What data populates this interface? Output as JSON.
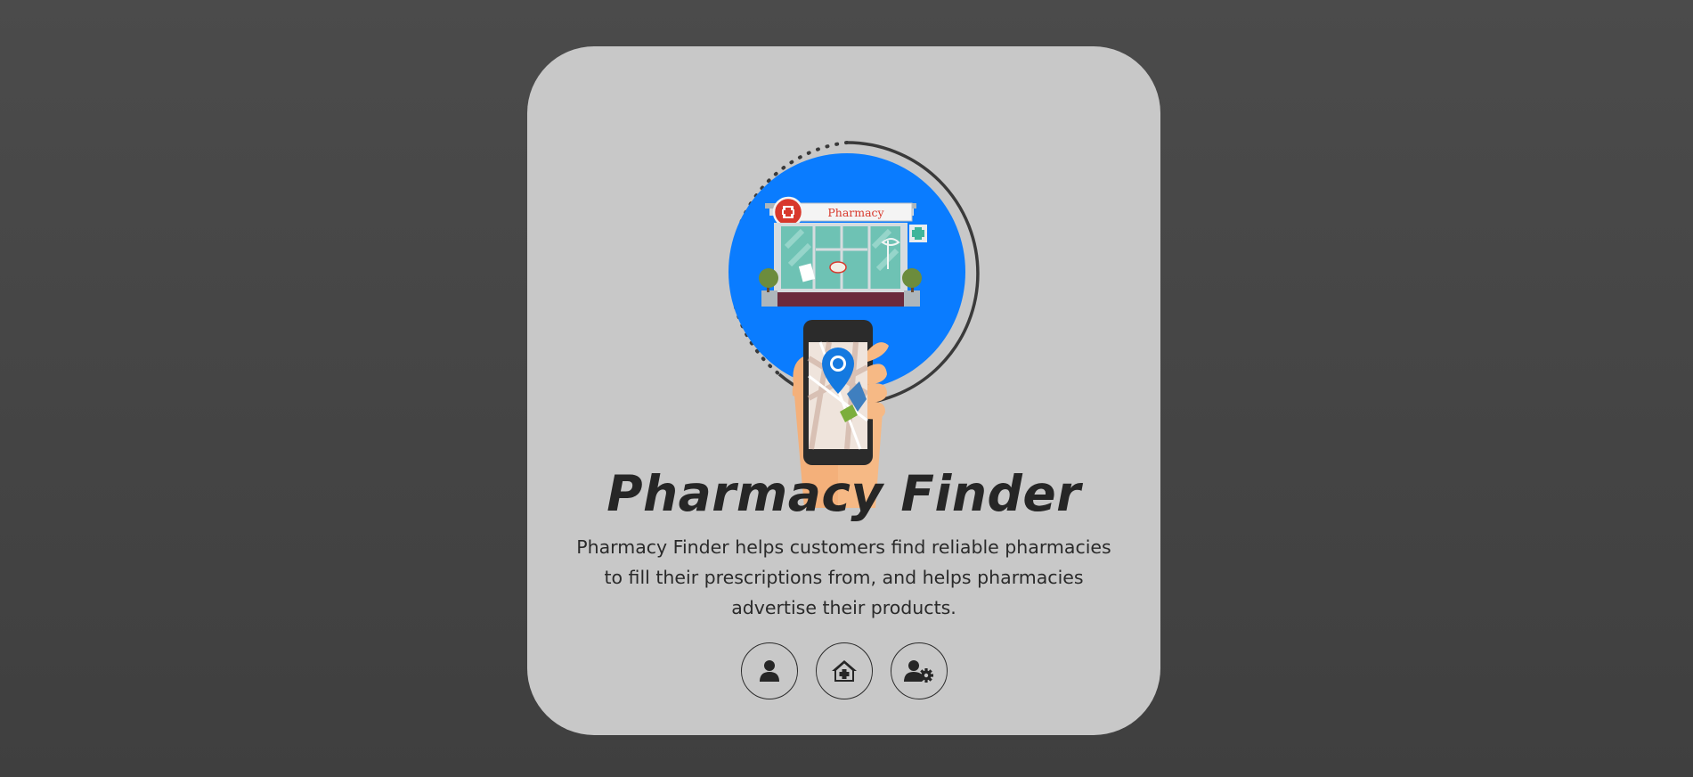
{
  "hero": {
    "sign_text": "Pharmacy"
  },
  "title": "Pharmacy Finder",
  "description": "Pharmacy Finder helps customers find reliable pharmacies to fill their prescriptions from, and helps pharmacies advertise their products.",
  "actions": [
    {
      "icon": "user-icon"
    },
    {
      "icon": "house-medical-icon"
    },
    {
      "icon": "user-gear-icon"
    }
  ],
  "colors": {
    "page_background": "#474747",
    "card_background": "#c8c8c8",
    "hero_circle": "#0a7cff",
    "text": "#262626"
  }
}
